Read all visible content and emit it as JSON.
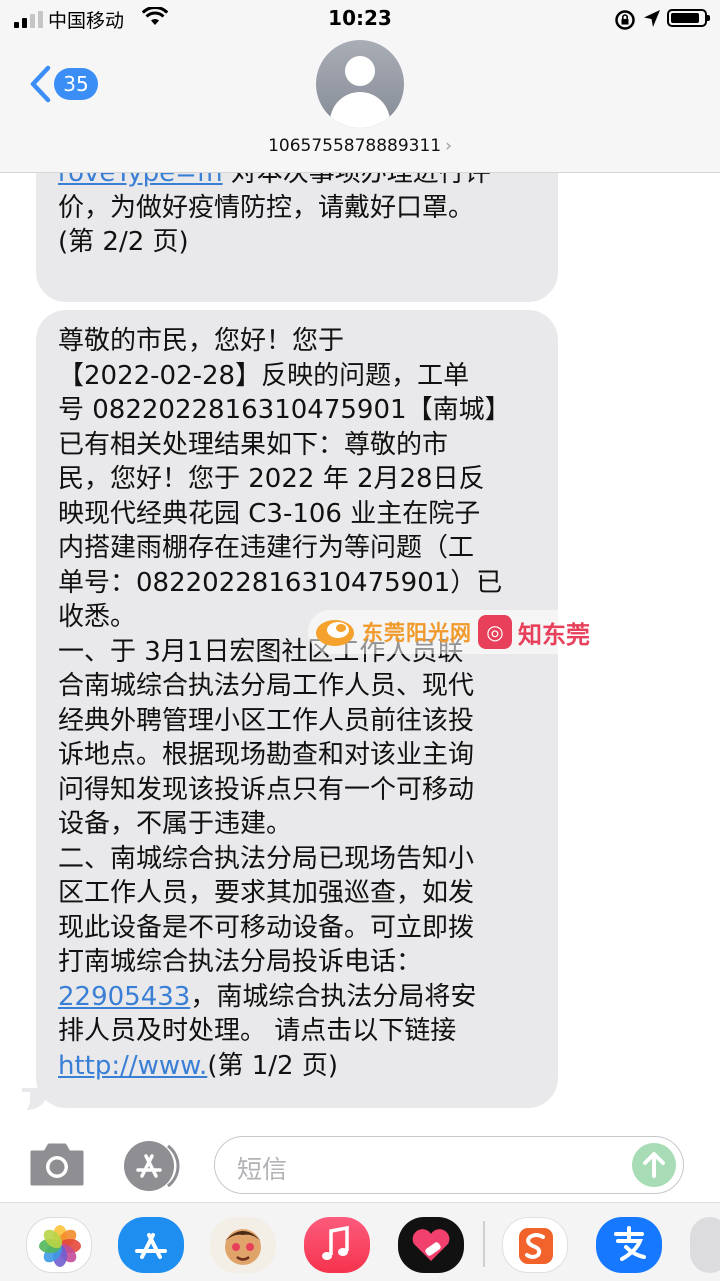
{
  "status_bar": {
    "carrier": "中国移动",
    "time": "10:23"
  },
  "header": {
    "unread_count": "35",
    "sender_number": "1065755878889311",
    "chevron": "›"
  },
  "messages": [
    {
      "lines": [
        {
          "link": "roveType=fh",
          "text": " 对本次事项办理进行评"
        },
        {
          "text": "价，为做好疫情防控，请戴好口罩。"
        },
        {
          "text": "(第 2/2 页)"
        }
      ]
    },
    {
      "lines": [
        {
          "text": "尊敬的市民，您好！您于"
        },
        {
          "text": "【2022-02-28】反映的问题，工单"
        },
        {
          "text": "号 0822022816310475901【南城】"
        },
        {
          "text": "已有相关处理结果如下：尊敬的市"
        },
        {
          "text": "民，您好！您于 2022 年 2月28日反"
        },
        {
          "text": "映现代经典花园 C3-106 业主在院子"
        },
        {
          "text": "内搭建雨棚存在违建行为等问题（工"
        },
        {
          "text": "单号：0822022816310475901）已"
        },
        {
          "text": "收悉。"
        },
        {
          "text": "一、于 3月1日宏图社区工作人员联"
        },
        {
          "text": "合南城综合执法分局工作人员、现代"
        },
        {
          "text": "经典外聘管理小区工作人员前往该投"
        },
        {
          "text": "诉地点。根据现场勘查和对该业主询"
        },
        {
          "text": "问得知发现该投诉点只有一个可移动"
        },
        {
          "text": "设备，不属于违建。"
        },
        {
          "text": "二、南城综合执法分局已现场告知小"
        },
        {
          "text": "区工作人员，要求其加强巡查，如发"
        },
        {
          "text": "现此设备是不可移动设备。可立即拨"
        },
        {
          "text": "打南城综合执法分局投诉电话："
        },
        {
          "link": "22905433",
          "text": "，南城综合执法分局将安"
        },
        {
          "text": "排人员及时处理。 请点击以下链接"
        },
        {
          "link": "http://www.",
          "text": "(第 1/2 页)"
        }
      ]
    }
  ],
  "watermark": {
    "brand1": "东莞阳光网",
    "brand2": "知东莞"
  },
  "composer": {
    "placeholder": "短信"
  },
  "app_drawer": [
    "photos-icon",
    "app-store-icon",
    "memoji-icon",
    "music-icon",
    "digital-touch-icon",
    "sogou-icon",
    "alipay-icon",
    "more-apps-icon"
  ],
  "colors": {
    "link": "#3a7fd6",
    "badge": "#3a8ef6",
    "bubble": "#e9e9eb",
    "send": "#a7dcb6"
  }
}
